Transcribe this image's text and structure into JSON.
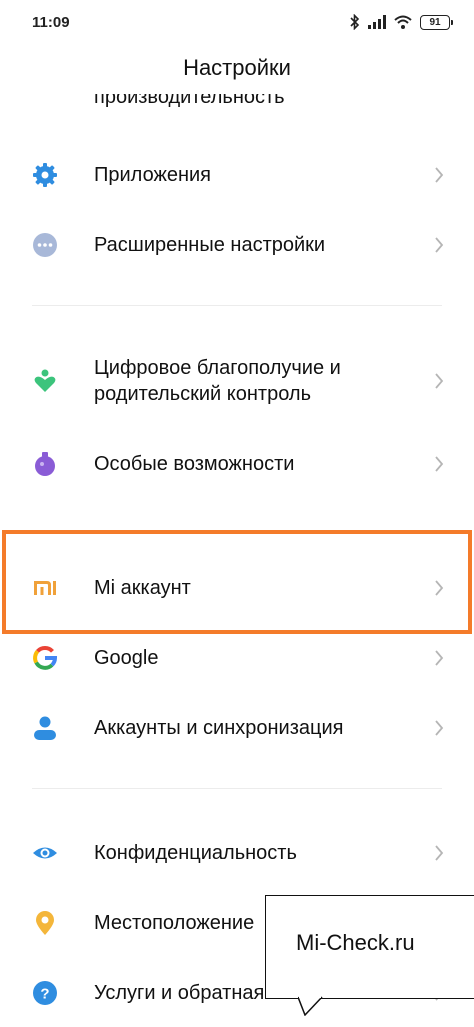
{
  "status": {
    "time": "11:09",
    "battery": "91"
  },
  "header": {
    "title": "Настройки"
  },
  "cut_item": "производительность",
  "items": [
    {
      "label": "Приложения",
      "icon": "gear-icon",
      "color": "#2f8de0"
    },
    {
      "label": "Расширенные настройки",
      "icon": "more-dots-icon",
      "color": "#a8b8d8"
    },
    {
      "label": "Цифровое благополучие и родительский контроль",
      "line1": "Цифровое благополучие и",
      "line2": "родительский контроль",
      "icon": "wellbeing-heart-icon",
      "color": "#3cc47c"
    },
    {
      "label": "Особые возможности",
      "icon": "accessibility-flask-icon",
      "color": "#8a5cd6"
    },
    {
      "label": "Mi аккаунт",
      "icon": "mi-logo-icon",
      "color": "#f0a13a"
    },
    {
      "label": "Google",
      "icon": "google-g-icon",
      "color": "#4285f4"
    },
    {
      "label": "Аккаунты и синхронизация",
      "icon": "person-icon",
      "color": "#2f8de0"
    },
    {
      "label": "Конфиденциальность",
      "icon": "eye-icon",
      "color": "#2f8de0"
    },
    {
      "label": "Местоположение",
      "icon": "location-pin-icon",
      "color": "#f4b63a"
    },
    {
      "label": "Услуги и обратная связь",
      "icon": "help-question-icon",
      "color": "#2f8de0"
    }
  ],
  "highlight_color": "#f47b2a",
  "watermark": {
    "text": "Mi-Check.ru"
  }
}
